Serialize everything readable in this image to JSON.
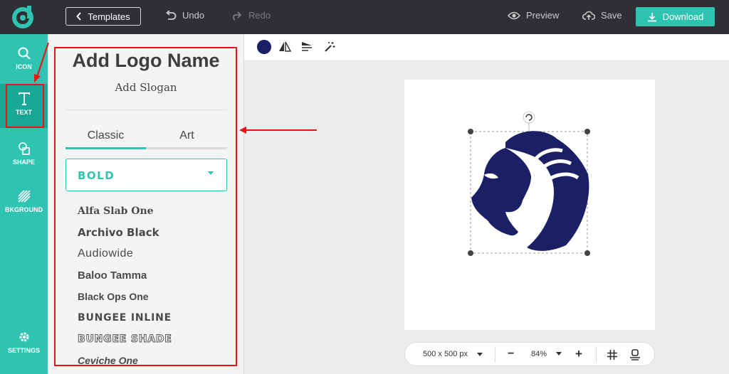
{
  "topbar": {
    "templates_label": "Templates",
    "undo_label": "Undo",
    "redo_label": "Redo",
    "preview_label": "Preview",
    "save_label": "Save",
    "download_label": "Download"
  },
  "leftnav": {
    "items": [
      {
        "label": "ICON",
        "icon": "search-icon"
      },
      {
        "label": "TEXT",
        "icon": "text-icon",
        "active": true
      },
      {
        "label": "SHAPE",
        "icon": "shape-icon"
      },
      {
        "label": "BKGROUND",
        "icon": "background-icon"
      },
      {
        "label": "SETTINGS",
        "icon": "gear-icon"
      }
    ]
  },
  "panel": {
    "logo_name": "Add Logo Name",
    "slogan": "Add Slogan",
    "tabs": [
      {
        "label": "Classic",
        "active": true
      },
      {
        "label": "Art",
        "active": false
      }
    ],
    "font_category": "BOLD",
    "fonts": [
      "Alfa Slab One",
      "Archivo Black",
      "Audiowide",
      "Baloo Tamma",
      "Black Ops One",
      "BUNGEE INLINE",
      "BUNGEE SHADE",
      "Ceviche One"
    ]
  },
  "subbar": {
    "swatch_color": "#1a1f66",
    "tools": [
      "flip-icon",
      "align-icon",
      "magic-wand-icon"
    ]
  },
  "canvas": {
    "logo_color": "#1a1f66"
  },
  "zoombar": {
    "size_label": "500 x 500 px",
    "zoom_label": "84%"
  },
  "colors": {
    "accent": "#2fc3b2",
    "topbar": "#2e3033",
    "annotation": "#ee1111"
  }
}
